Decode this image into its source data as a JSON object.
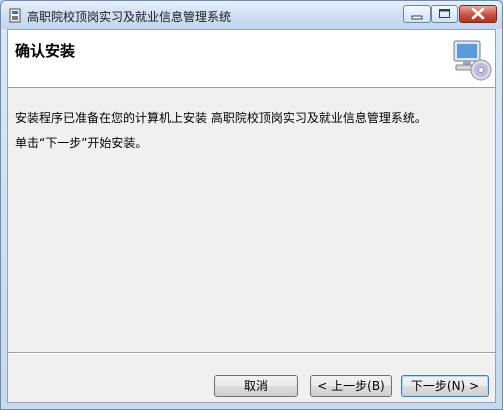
{
  "window": {
    "title": "高职院校顶岗实习及就业信息管理系统"
  },
  "header": {
    "title": "确认安装",
    "icon": "computer-cd-icon"
  },
  "content": {
    "line1": "安装程序已准备在您的计算机上安装 高职院校顶岗实习及就业信息管理系统。",
    "line2": "单击“下一步”开始安装。"
  },
  "buttons": {
    "cancel": "取消",
    "back": "< 上一步(B)",
    "next": "下一步(N) >"
  },
  "colors": {
    "close_button": "#c7523f",
    "titlebar": "#d1e1f4",
    "header_bg": "#ffffff",
    "client_bg": "#f0f0f0"
  }
}
